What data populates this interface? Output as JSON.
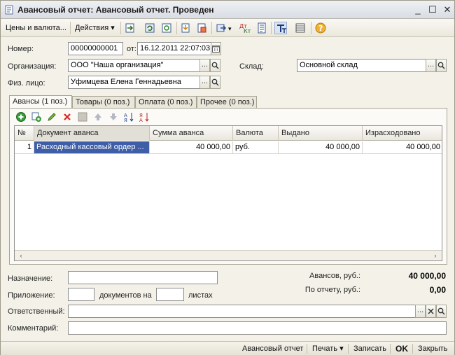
{
  "window": {
    "title": "Авансовый отчет: Авансовый отчет. Проведен",
    "minimize": "_",
    "maximize": "☐",
    "close": "✕"
  },
  "toolbar": {
    "prices_currency": "Цены и валюта...",
    "actions": "Действия"
  },
  "header": {
    "number_label": "Номер:",
    "number_value": "00000000001",
    "date_label": "от:",
    "date_value": "16.12.2011 22:07:03",
    "org_label": "Организация:",
    "org_value": "ООО \"Наша организация\"",
    "warehouse_label": "Склад:",
    "warehouse_value": "Основной склад",
    "person_label": "Физ. лицо:",
    "person_value": "Уфимцева Елена Геннадьевна"
  },
  "tabs": [
    {
      "label": "Авансы (1 поз.)"
    },
    {
      "label": "Товары (0 поз.)"
    },
    {
      "label": "Оплата (0 поз.)"
    },
    {
      "label": "Прочее (0 поз.)"
    }
  ],
  "grid": {
    "columns": [
      "№",
      "Документ аванса",
      "Сумма аванса",
      "Валюта",
      "Выдано",
      "Израсходовано"
    ],
    "rows": [
      {
        "n": "1",
        "doc": "Расходный кассовый ордер ...",
        "sum": "40 000,00",
        "currency": "руб.",
        "issued": "40 000,00",
        "spent": "40 000,00"
      }
    ]
  },
  "footer": {
    "purpose_label": "Назначение:",
    "purpose_value": "",
    "attachment_label": "Приложение:",
    "docs_on": "документов на",
    "sheets": "листах",
    "attachment_docs": "",
    "attachment_sheets": "",
    "advances_label": "Авансов, руб.:",
    "advances_value": "40 000,00",
    "report_label": "По отчету, руб.:",
    "report_value": "0,00",
    "responsible_label": "Ответственный:",
    "responsible_value": "",
    "comment_label": "Комментарий:",
    "comment_value": ""
  },
  "statusbar": {
    "report": "Авансовый отчет",
    "print": "Печать",
    "save": "Записать",
    "ok": "OK",
    "close": "Закрыть"
  },
  "colors": {
    "selection": "#3e5ea8",
    "background": "#f3f1e8"
  }
}
